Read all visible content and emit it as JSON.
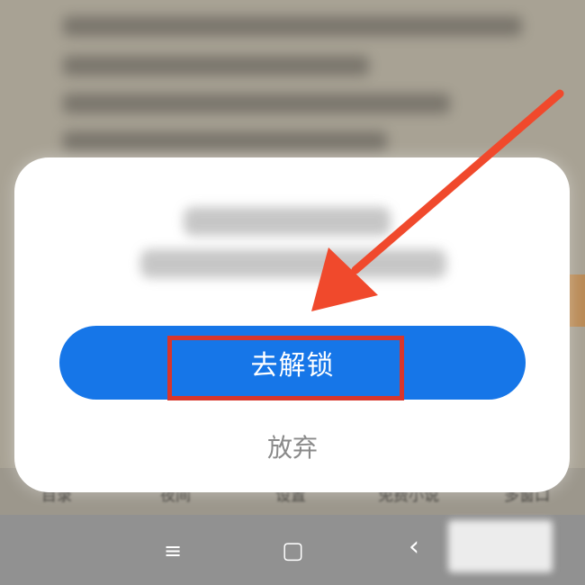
{
  "background_tabs": [
    "目录",
    "夜间",
    "设置",
    "免费小说",
    "多窗口"
  ],
  "dialog": {
    "primary_label": "去解锁",
    "secondary_label": "放弃"
  },
  "navbar": {
    "menu_icon": "≡",
    "home_icon": "▢",
    "back_icon": "‹"
  },
  "colors": {
    "primary": "#1676e8",
    "highlight": "#d8362b",
    "arrow": "#f0492c"
  }
}
